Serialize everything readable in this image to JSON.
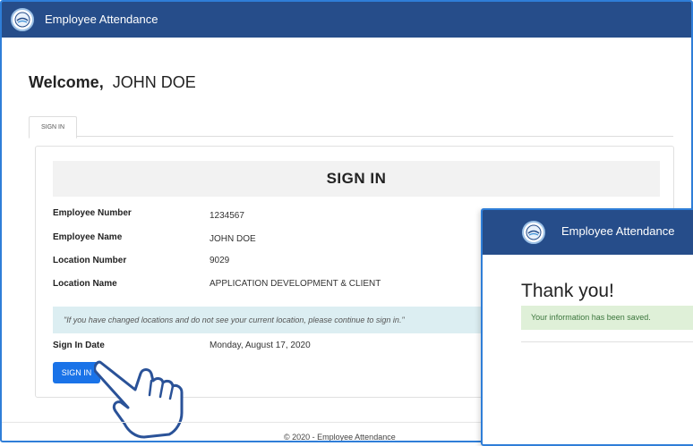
{
  "app": {
    "title": "Employee Attendance"
  },
  "welcome": {
    "label": "Welcome,",
    "name": "JOHN DOE"
  },
  "tab": {
    "label": "SIGN IN"
  },
  "card": {
    "heading": "SIGN IN"
  },
  "fields": [
    {
      "label": "Employee Number",
      "value": "1234567"
    },
    {
      "label": "Employee Name",
      "value": "JOHN DOE"
    },
    {
      "label": "Location Number",
      "value": "9029"
    },
    {
      "label": "Location Name",
      "value": "APPLICATION DEVELOPMENT & CLIENT"
    }
  ],
  "notice": "\"If you have changed locations and do not see your current location, please continue to sign in.\"",
  "sign_in_date": {
    "label": "Sign In Date",
    "value": "Monday, August 17, 2020"
  },
  "button": {
    "label": "SIGN IN"
  },
  "footer": "© 2020 - Employee Attendance",
  "popup": {
    "app_title": "Employee Attendance",
    "heading": "Thank you!",
    "message": "Your information has been saved."
  },
  "colors": {
    "header": "#264d8a",
    "primary_button": "#1a73e8",
    "success_bg": "#dff0d8",
    "notice_bg": "#dceef2",
    "frame_border": "#2f7ed8"
  }
}
